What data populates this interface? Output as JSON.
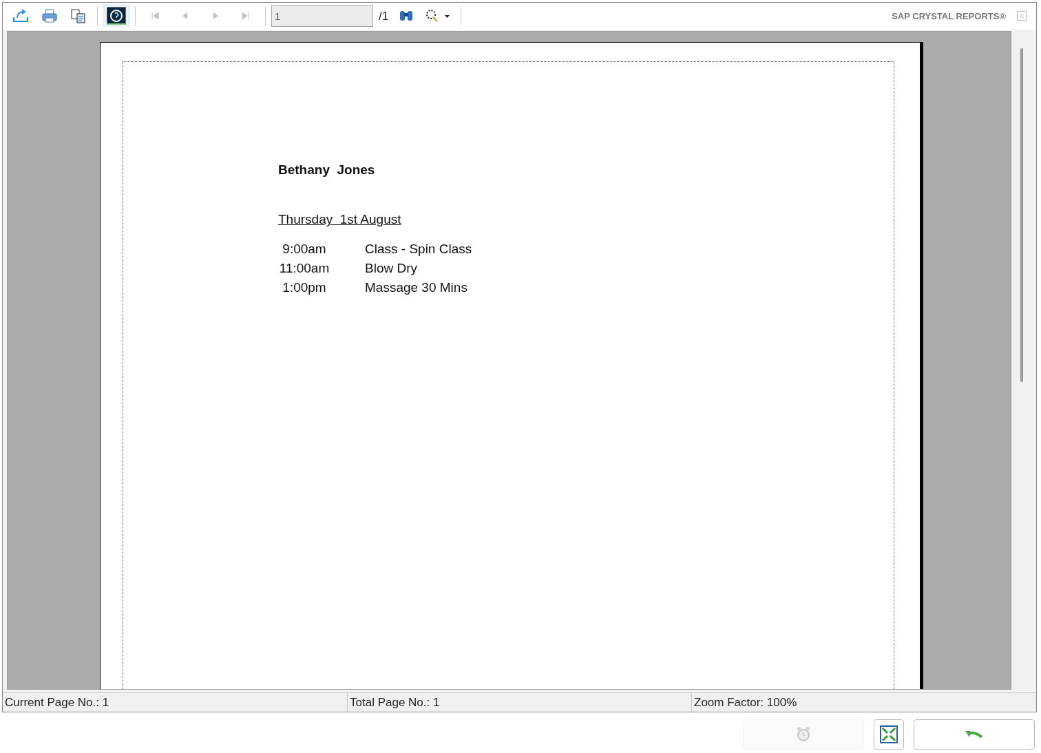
{
  "toolbar": {
    "buttons": [
      {
        "kind": "export",
        "disabled": false
      },
      {
        "kind": "print",
        "disabled": false
      },
      {
        "kind": "copy",
        "disabled": false
      },
      {
        "kind": "tree",
        "disabled": false,
        "selected": true
      },
      {
        "kind": "first",
        "disabled": true
      },
      {
        "kind": "prev",
        "disabled": true
      },
      {
        "kind": "next",
        "disabled": true
      },
      {
        "kind": "last",
        "disabled": true
      }
    ],
    "page_field": {
      "value": "1"
    },
    "page_total": "/1",
    "tools": [
      {
        "kind": "find"
      },
      {
        "kind": "zoom"
      }
    ],
    "brand": "SAP CRYSTAL REPORTS®"
  },
  "report": {
    "name": "Bethany  Jones",
    "date": "Thursday  1st August",
    "rows": [
      {
        "time": "9:00am",
        "activity": "Class - Spin Class"
      },
      {
        "time": "11:00am",
        "activity": "Blow Dry"
      },
      {
        "time": "1:00pm",
        "activity": "Massage 30 Mins"
      }
    ]
  },
  "status_bar": [
    "Current Page No.: 1",
    "Total Page No.: 1",
    "Zoom Factor: 100%"
  ],
  "bottom_buttons": [
    {
      "kind": "alarm",
      "disabled": true
    },
    {
      "kind": "fit"
    },
    {
      "kind": "undo"
    }
  ]
}
